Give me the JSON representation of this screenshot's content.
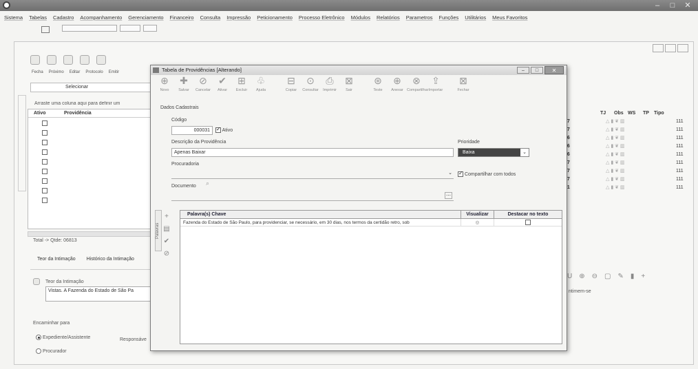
{
  "menu": [
    "Sistema",
    "Tabelas",
    "Cadastro",
    "Acompanhamento",
    "Gerenciamento",
    "Financeiro",
    "Consulta",
    "Impressão",
    "Peticionamento",
    "Processo Eletrônico",
    "Módulos",
    "Relatórios",
    "Parametros",
    "Funções",
    "Utilitários",
    "Meus Favoritos"
  ],
  "background": {
    "toolbar_labels": [
      "Fecha",
      "Próximo",
      "Editar",
      "Protocolo",
      "Emitir"
    ],
    "selecionar": "Selecionar",
    "group_hint": "Arraste uma coluna aqui para definir um",
    "grid_headers": [
      "Ativo",
      "Providência"
    ],
    "total": "Total -> Qtde: 06813",
    "tabs": [
      "Teor da Intimação",
      "Histórico da Intimação"
    ],
    "teor_label": "Teor da Intimação",
    "teor_text": "Vistas. A Fazenda do Estado de São Pa",
    "encaminhar": "Encaminhar para",
    "radio1": "Expediente/Assistente",
    "radio2": "Procurador",
    "responsavel": "Responsáve",
    "right_headers": [
      "TJ",
      "Obs",
      "WS",
      "TP",
      "Tipo"
    ],
    "right_rows": [
      "07",
      "07",
      "66",
      "66",
      "66",
      "07",
      "07",
      "07",
      "71"
    ],
    "tipo_vals": [
      "111",
      "111",
      "111",
      "111",
      "111",
      "111",
      "111",
      "111",
      "111"
    ],
    "right_text": "ntimem-se"
  },
  "dialog": {
    "title": "Tabela de Providências  [Alterando]",
    "toolbar": [
      "Novo",
      "Salvar",
      "Cancelar",
      "Ativar",
      "Excluir",
      "Ajuda",
      "Copiar",
      "Consultar",
      "Imprimir",
      "Sair",
      "Teste",
      "Anexar",
      "Compartilhar",
      "Importar",
      "Fechar"
    ],
    "section": "Dados Cadastrais",
    "codigo_label": "Código",
    "codigo_value": "000031",
    "ativo_label": "Ativo",
    "descricao_label": "Descrição da Providência",
    "descricao_value": "Apenas Baixar",
    "prioridade_label": "Prioridade",
    "prioridade_value": "Baixa",
    "procuradoria_label": "Procuradoria",
    "compartilhar_label": "Compartilhar com todos",
    "documento_label": "Documento",
    "kw_headers": [
      "Palavra(s) Chave",
      "Visualizar",
      "Destacar no texto"
    ],
    "kw_rows": [
      {
        "text": "Fazenda do Estado de São Paulo, para providenciar, se necessário, em 30 dias, nos termos da certidão retro, sob"
      }
    ],
    "side_label": "Palavras"
  },
  "colors": {
    "accent": "#777777",
    "grid_header": "#223"
  }
}
